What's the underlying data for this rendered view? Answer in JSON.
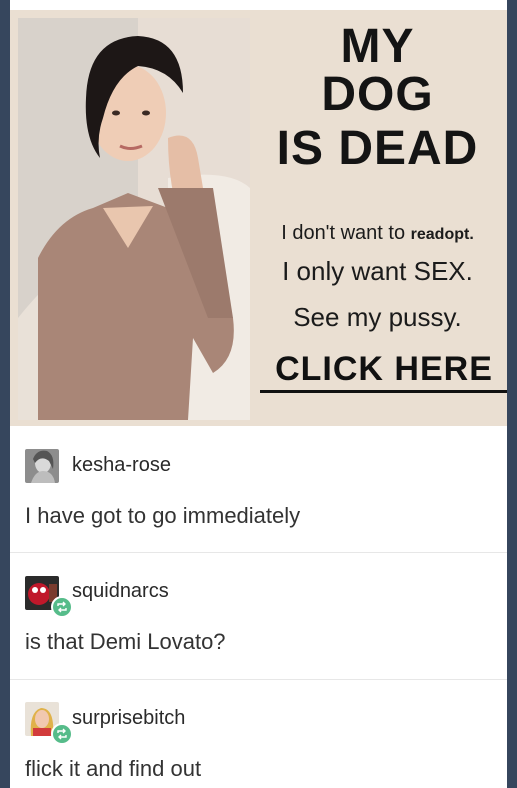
{
  "ad": {
    "headline": [
      "MY",
      "DOG",
      "IS DEAD"
    ],
    "line1_main": "I don't want to ",
    "line1_small": "readopt.",
    "line2": "I only want SEX.",
    "line3": "See my pussy.",
    "cta": "CLICK HERE"
  },
  "notes": [
    {
      "username": "kesha-rose",
      "comment": "I have got to go immediately",
      "avatar": "user-avatar-icon",
      "reblogged": false
    },
    {
      "username": "squidnarcs",
      "comment": "is that Demi Lovato?",
      "avatar": "user-avatar-icon",
      "reblogged": true
    },
    {
      "username": "surprisebitch",
      "comment": "flick it and find out",
      "avatar": "user-avatar-icon",
      "reblogged": true
    }
  ],
  "colors": {
    "background": "#36465d",
    "card": "#ffffff",
    "reblog": "#56bc8a",
    "ad_bg": "#eadfd2"
  }
}
